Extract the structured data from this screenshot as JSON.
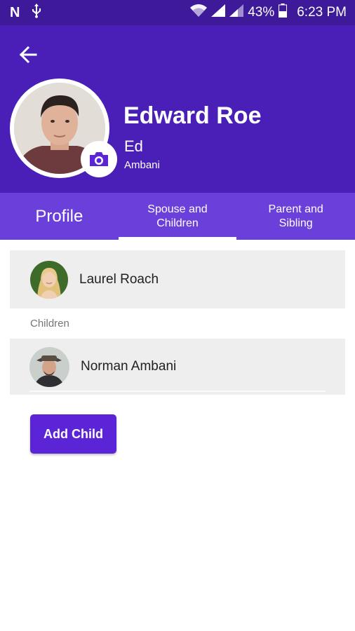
{
  "status_bar": {
    "battery": "43%",
    "time": "6:23 PM",
    "icons": [
      "n-icon",
      "usb-icon",
      "wifi-icon",
      "signal-icon",
      "signal-icon-2",
      "battery-icon"
    ]
  },
  "header": {
    "name": "Edward Roe",
    "nickname": "Ed",
    "surname": "Ambani"
  },
  "tabs": [
    {
      "label": "Profile",
      "active": false
    },
    {
      "label": "Spouse and\nChildren",
      "active": true
    },
    {
      "label": "Parent and\nSibling",
      "active": false
    }
  ],
  "spouse": {
    "name": "Laurel Roach"
  },
  "children_section": {
    "label": "Children",
    "items": [
      {
        "name": "Norman Ambani"
      }
    ]
  },
  "add_child_label": "Add Child",
  "colors": {
    "status_bar": "#3e1a9a",
    "header": "#4a1fb8",
    "tabs": "#6b3fd9",
    "accent_button": "#5b24d6",
    "card_bg": "#eeeeee"
  }
}
